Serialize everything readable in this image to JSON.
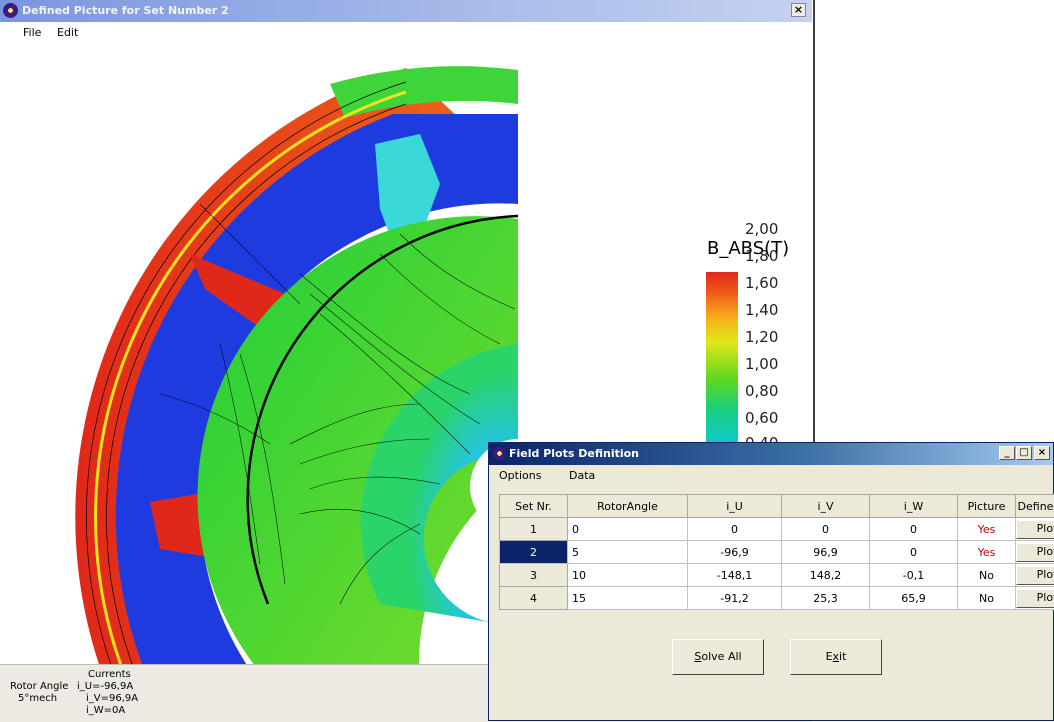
{
  "main_window": {
    "title": "Defined Picture for Set Number 2",
    "close_glyph": "×",
    "menu": [
      "File",
      "Edit"
    ]
  },
  "legend": {
    "title": "B_ABS(T)",
    "ticks": [
      "2,00",
      "1,80",
      "1,60",
      "1,40",
      "1,20",
      "1,00",
      "0,80",
      "0,60",
      "0,40"
    ]
  },
  "status": {
    "currents_label": "Currents",
    "rotor_angle_label": "Rotor Angle",
    "rotor_angle_value": "5°mech",
    "i_u": "i_U=-96,9A",
    "i_v": "i_V=96,9A",
    "i_w": "i_W=0A"
  },
  "dialog": {
    "title": "Field Plots Definition",
    "menu": [
      "Options",
      "Data"
    ],
    "window_buttons": {
      "minimize": "_",
      "maximize": "□",
      "close": "×"
    },
    "columns": [
      "Set Nr.",
      "RotorAngle",
      "i_U",
      "i_V",
      "i_W",
      "Picture",
      "Define"
    ],
    "rows": [
      {
        "set": "1",
        "angle": "0",
        "iu": "0",
        "iv": "0",
        "iw": "0",
        "picture": "Yes",
        "define": "Plot"
      },
      {
        "set": "2",
        "angle": "5",
        "iu": "-96,9",
        "iv": "96,9",
        "iw": "0",
        "picture": "Yes",
        "define": "Plot"
      },
      {
        "set": "3",
        "angle": "10",
        "iu": "-148,1",
        "iv": "148,2",
        "iw": "-0,1",
        "picture": "No",
        "define": "Plot"
      },
      {
        "set": "4",
        "angle": "15",
        "iu": "-91,2",
        "iv": "25,3",
        "iw": "65,9",
        "picture": "No",
        "define": "Plot"
      }
    ],
    "selected_set": "2",
    "solve_all_pre": "",
    "solve_all_u": "S",
    "solve_all_post": "olve All",
    "exit_pre": "E",
    "exit_u": "x",
    "exit_post": "it"
  }
}
